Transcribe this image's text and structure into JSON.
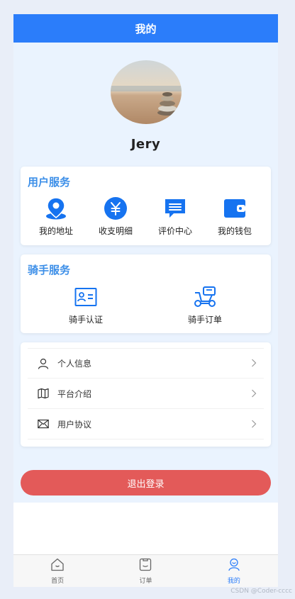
{
  "header": {
    "title": "我的"
  },
  "profile": {
    "username": "Jery"
  },
  "user_services": {
    "title": "用户服务",
    "items": [
      {
        "label": "我的地址",
        "icon": "location-pin-icon"
      },
      {
        "label": "收支明细",
        "icon": "yen-circle-icon"
      },
      {
        "label": "评价中心",
        "icon": "comment-icon"
      },
      {
        "label": "我的钱包",
        "icon": "wallet-icon"
      }
    ]
  },
  "rider_services": {
    "title": "骑手服务",
    "items": [
      {
        "label": "骑手认证",
        "icon": "id-card-icon"
      },
      {
        "label": "骑手订单",
        "icon": "scooter-icon"
      }
    ]
  },
  "menu": [
    {
      "label": "个人信息",
      "icon": "user-icon"
    },
    {
      "label": "平台介绍",
      "icon": "map-icon"
    },
    {
      "label": "用户协议",
      "icon": "mail-icon"
    }
  ],
  "logout_label": "退出登录",
  "tabbar": [
    {
      "label": "首页",
      "icon": "home-icon",
      "active": false
    },
    {
      "label": "订单",
      "icon": "order-icon",
      "active": false
    },
    {
      "label": "我的",
      "icon": "profile-icon",
      "active": true
    }
  ],
  "watermark": "CSDN @Coder-cccc",
  "colors": {
    "primary": "#2b7dfa",
    "title_blue": "#3d8fe8",
    "logout": "#e35a59",
    "content_bg": "#eaf3fe"
  }
}
